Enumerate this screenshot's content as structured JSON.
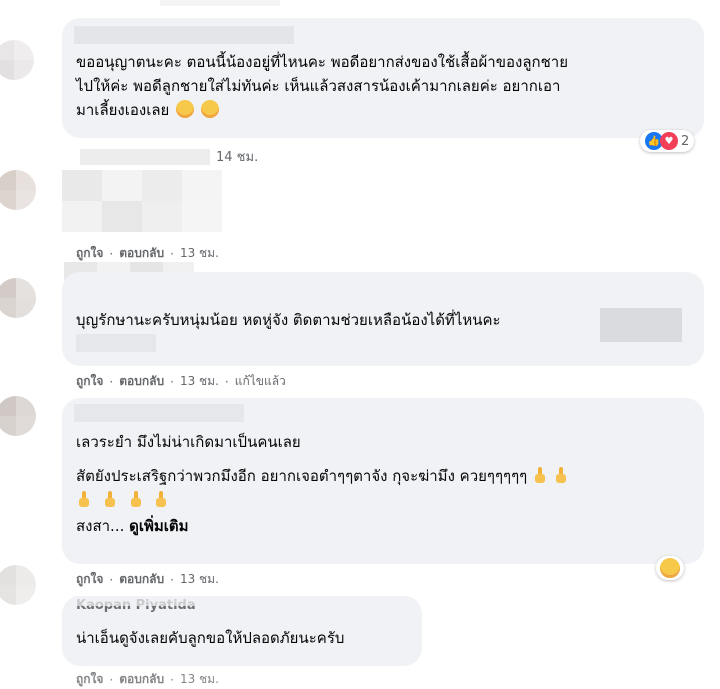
{
  "comments": [
    {
      "id": "c1",
      "text_lines": [
        "ขออนุญาตนะคะ ตอนนี้น้องอยู่ที่ไหนคะ พอดีอยากส่งของใช้เสื้อผ้าของลูกชาย",
        "ไปให้ค่ะ พอดีลูกชายใส่ไม่ทันค่ะ เห็นแล้วสงสารน้องเค้ามากเลยค่ะ อยากเอา",
        "มาเลี้ยงเองเลย"
      ],
      "time": "14 ชม.",
      "reaction_count": "2",
      "reaction_icons": [
        "like-icon",
        "love-icon"
      ]
    },
    {
      "id": "c2",
      "like": "ถูกใจ",
      "reply": "ตอบกลับ",
      "time": "13 ชม."
    },
    {
      "id": "c3",
      "text_lines": [
        "บุญรักษานะครับหนุ่มน้อย หดหู่จัง ติดตามช่วยเหลือน้องได้ที่ไหนคะ"
      ],
      "like": "ถูกใจ",
      "reply": "ตอบกลับ",
      "time": "13 ชม.",
      "edited": "แก้ไขแล้ว"
    },
    {
      "id": "c4",
      "text_lines": [
        "เลวระยำ มึงไม่น่าเกิดมาเป็นคนเลย",
        "สัตยังประเสริฐกว่าพวกมึงอีก อยากเจอตำๆๆตาจัง กุจะฆ่ามึง ควยๆๆๆๆๆ"
      ],
      "truncated": "สงสา...",
      "see_more": "ดูเพิ่มเติม",
      "like": "ถูกใจ",
      "reply": "ตอบกลับ",
      "time": "13 ชม.",
      "reaction_icons": [
        "sad-icon"
      ]
    },
    {
      "id": "c5",
      "author": "Kaopan Piyatida",
      "text_lines": [
        "น่าเอ็นดูจังเลยคับลูกขอให้ปลอดภัยนะครับ"
      ],
      "like": "ถูกใจ",
      "reply": "ตอบกลับ",
      "time": "13 ชม."
    }
  ],
  "colors": {
    "bubble": "#f0f2f5",
    "meta_text": "#65676b",
    "like_blue": "#1877f2",
    "love_red": "#f33e58",
    "emoji_yellow": "#f7c94b"
  }
}
